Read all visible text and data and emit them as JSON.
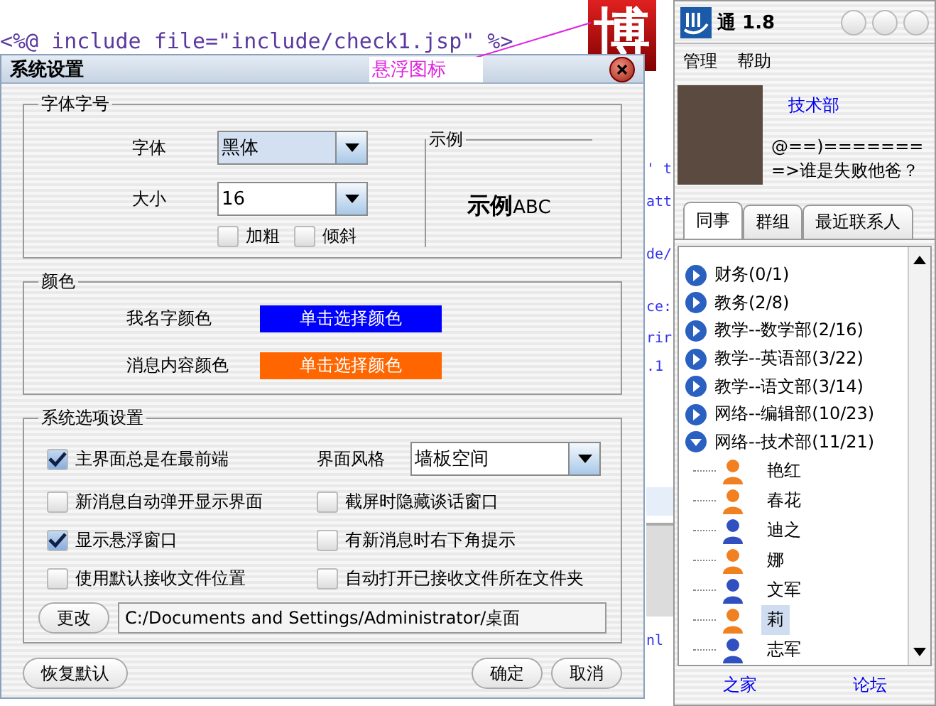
{
  "editor": {
    "code_line": "<%@ include file=\"include/check1.jsp\" %>",
    "fragments": [
      "' t",
      "att",
      "de/",
      "ce:",
      "rir",
      ".1",
      "nl"
    ]
  },
  "floating_icon": {
    "glyph": "博",
    "callout": "悬浮图标"
  },
  "dialog": {
    "title": "系统设置",
    "font_group": {
      "title": "字体字号",
      "font_label": "字体",
      "font_value": "黑体",
      "size_label": "大小",
      "size_value": "16",
      "bold": {
        "label": "加粗",
        "checked": false
      },
      "italic": {
        "label": "倾斜",
        "checked": false
      },
      "preview": {
        "title": "示例",
        "sample": "**示例**ABC"
      }
    },
    "color_group": {
      "title": "颜色",
      "rows": [
        {
          "label": "我名字颜色",
          "button": "单击选择颜色",
          "color": "#0000ff"
        },
        {
          "label": "消息内容颜色",
          "button": "单击选择颜色",
          "color": "#ff6600"
        }
      ]
    },
    "options_group": {
      "title": "系统选项设置",
      "options": [
        {
          "kind": "checkbox",
          "label": "主界面总是在最前端",
          "checked": true
        },
        {
          "kind": "select",
          "label": "界面风格",
          "value": "墙板空间"
        },
        {
          "kind": "checkbox",
          "label": "新消息自动弹开显示界面",
          "checked": false
        },
        {
          "kind": "checkbox",
          "label": "截屏时隐藏谈话窗口",
          "checked": false
        },
        {
          "kind": "checkbox",
          "label": "显示悬浮窗口",
          "checked": true
        },
        {
          "kind": "checkbox",
          "label": "有新消息时右下角提示",
          "checked": false
        },
        {
          "kind": "checkbox",
          "label": "使用默认接收文件位置",
          "checked": false
        },
        {
          "kind": "checkbox",
          "label": "自动打开已接收文件所在文件夹",
          "checked": false
        }
      ],
      "change_button": "更改",
      "path": "C:/Documents and Settings/Administrator/桌面"
    },
    "buttons": {
      "reset": "恢复默认",
      "ok": "确定",
      "cancel": "取消"
    }
  },
  "app": {
    "title": "通 1.8",
    "menu": [
      "管理",
      "帮助"
    ],
    "profile": {
      "name": "技术部",
      "signature": "@==)========>谁是失败他爸？"
    },
    "tabs": [
      {
        "label": "同事",
        "selected": true
      },
      {
        "label": "群组",
        "selected": false
      },
      {
        "label": "最近联系人",
        "selected": false
      }
    ],
    "groups": [
      {
        "label": "财务(0/1)",
        "expanded": false
      },
      {
        "label": "教务(2/8)",
        "expanded": false
      },
      {
        "label": "教学--数学部(2/16)",
        "expanded": false
      },
      {
        "label": "教学--英语部(3/22)",
        "expanded": false
      },
      {
        "label": "教学--语文部(3/14)",
        "expanded": false
      },
      {
        "label": "网络--编辑部(10/23)",
        "expanded": false
      },
      {
        "label": "网络--技术部(11/21)",
        "expanded": true,
        "children": [
          {
            "name": "艳红",
            "color": "#f08020",
            "selected": false
          },
          {
            "name": "春花",
            "color": "#f08020",
            "selected": false
          },
          {
            "name": "迪之",
            "color": "#3050c0",
            "selected": false
          },
          {
            "name": "娜",
            "color": "#f08020",
            "selected": false
          },
          {
            "name": "文军",
            "color": "#3050c0",
            "selected": false
          },
          {
            "name": "莉",
            "color": "#f08020",
            "selected": true
          },
          {
            "name": "志军",
            "color": "#3050c0",
            "selected": false
          }
        ]
      }
    ],
    "links": [
      "之家",
      "论坛"
    ]
  }
}
